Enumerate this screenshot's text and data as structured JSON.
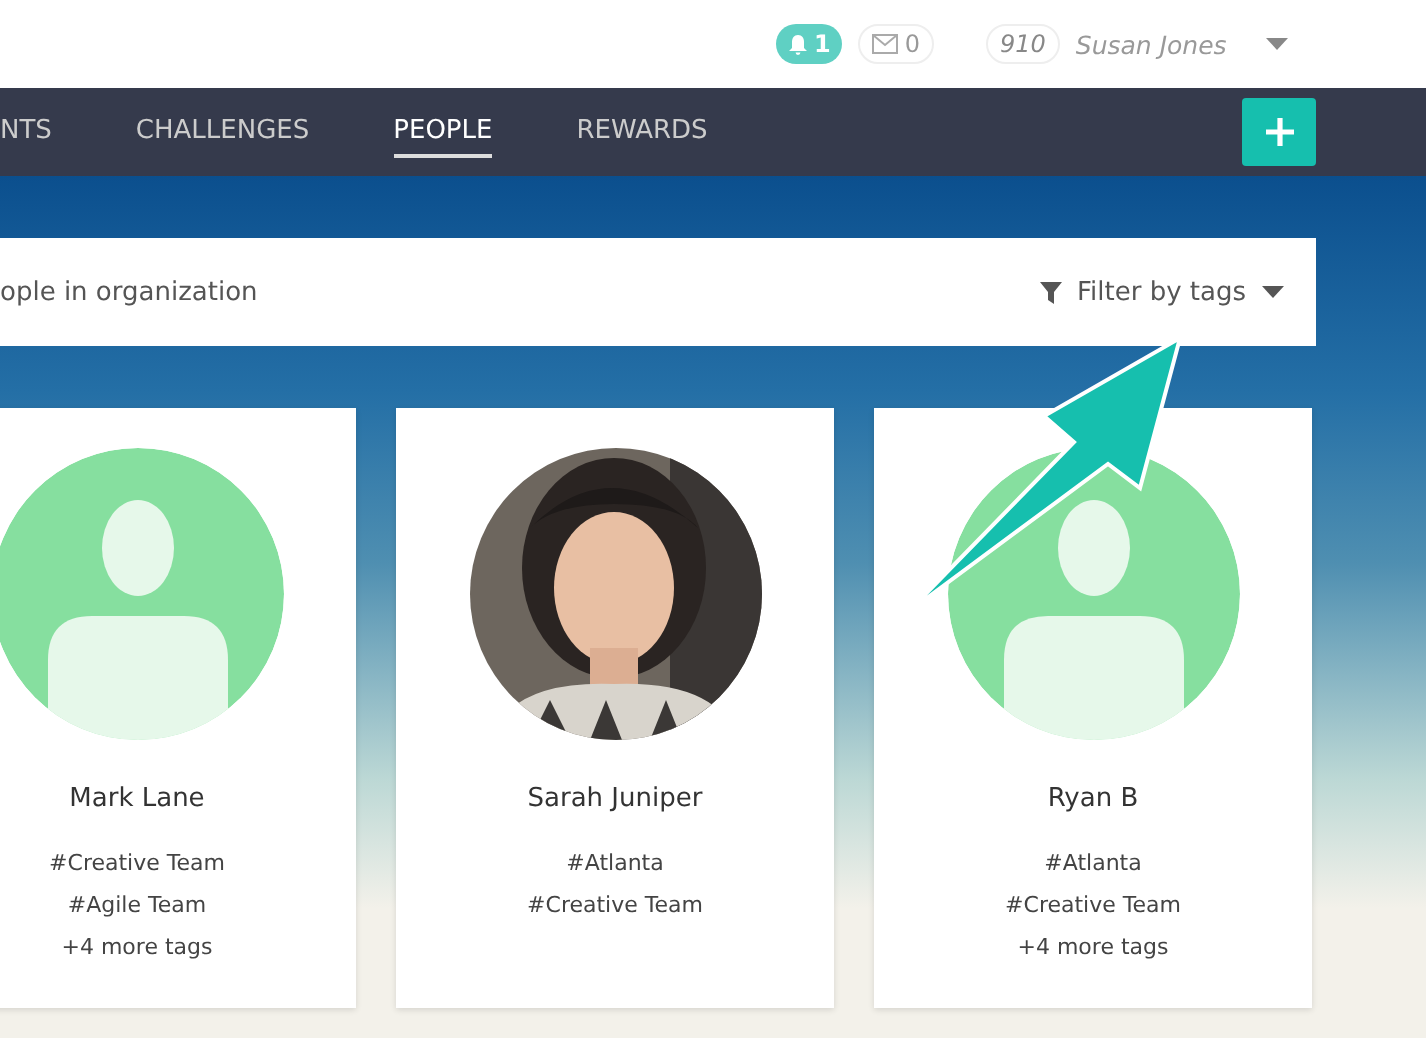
{
  "topbar": {
    "notifications": "1",
    "messages": "0",
    "points": "910",
    "user": "Susan Jones"
  },
  "tabs": [
    {
      "label": "NTS",
      "selected": false
    },
    {
      "label": "CHALLENGES",
      "selected": false
    },
    {
      "label": "PEOPLE",
      "selected": true
    },
    {
      "label": "REWARDS",
      "selected": false
    }
  ],
  "search": {
    "placeholder": "ople in organization",
    "filter": "Filter by tags"
  },
  "people": [
    {
      "name": "Mark Lane",
      "kind": "placeholder",
      "tags": [
        "#Creative Team",
        "#Agile Team"
      ],
      "more": "+4 more tags"
    },
    {
      "name": "Sarah Juniper",
      "tags": [
        "#Atlanta",
        "#Creative Team"
      ]
    },
    {
      "name": "Ryan B",
      "kind": "placeholder",
      "tags": [
        "#Atlanta",
        "#Creative Team"
      ],
      "more": "+4 more tags"
    }
  ]
}
